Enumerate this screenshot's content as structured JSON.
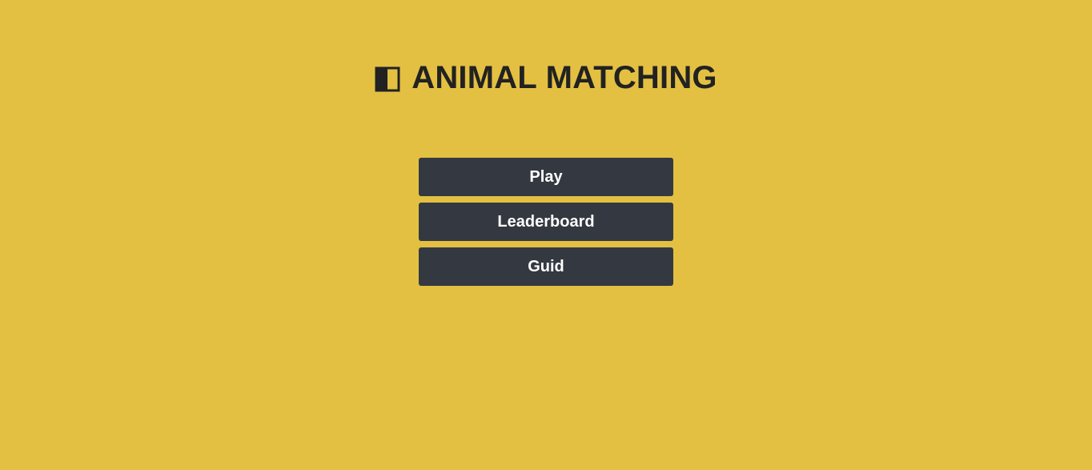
{
  "header": {
    "icon": "half-filled-square-icon",
    "title": "ANIMAL MATCHING"
  },
  "menu": {
    "buttons": [
      {
        "label": "Play"
      },
      {
        "label": "Leaderboard"
      },
      {
        "label": "Guid"
      }
    ]
  },
  "colors": {
    "background": "#e3c042",
    "button": "#343941",
    "button_text": "#ffffff",
    "title_text": "#222222"
  }
}
